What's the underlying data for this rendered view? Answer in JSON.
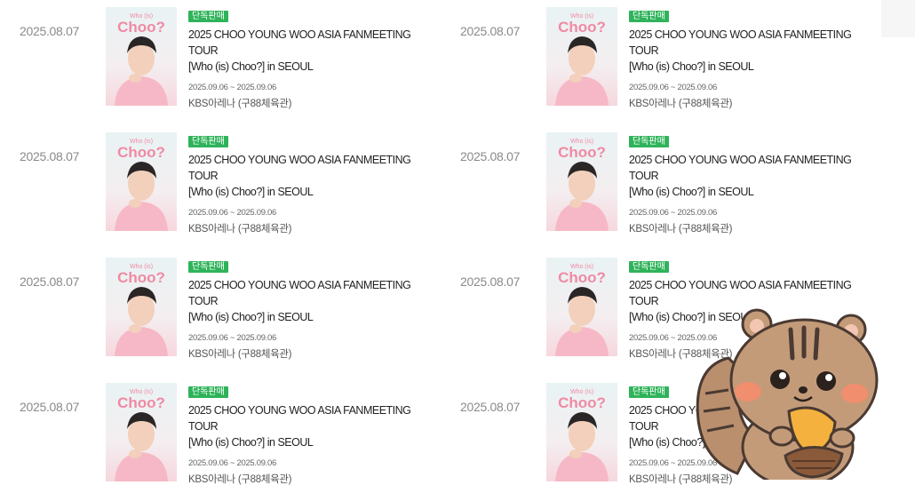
{
  "items": [
    {
      "date": "2025.08.07",
      "badge": "단독판매",
      "title_line1": "2025 CHOO YOUNG WOO ASIA FANMEETING TOUR",
      "title_line2": "[Who (is) Choo?] in SEOUL",
      "period": "2025.09.06 ~ 2025.09.06",
      "venue": "KBS아레나 (구88체육관)",
      "poster_text": "Choo?",
      "poster_small": "Who (is)"
    },
    {
      "date": "2025.08.07",
      "badge": "단독판매",
      "title_line1": "2025 CHOO YOUNG WOO ASIA FANMEETING TOUR",
      "title_line2": "[Who (is) Choo?] in SEOUL",
      "period": "2025.09.06 ~ 2025.09.06",
      "venue": "KBS아레나 (구88체육관)",
      "poster_text": "Choo?",
      "poster_small": "Who (is)"
    },
    {
      "date": "2025.08.07",
      "badge": "단독판매",
      "title_line1": "2025 CHOO YOUNG WOO ASIA FANMEETING TOUR",
      "title_line2": "[Who (is) Choo?] in SEOUL",
      "period": "2025.09.06 ~ 2025.09.06",
      "venue": "KBS아레나 (구88체육관)",
      "poster_text": "Choo?",
      "poster_small": "Who (is)"
    },
    {
      "date": "2025.08.07",
      "badge": "단독판매",
      "title_line1": "2025 CHOO YOUNG WOO ASIA FANMEETING TOUR",
      "title_line2": "[Who (is) Choo?] in SEOUL",
      "period": "2025.09.06 ~ 2025.09.06",
      "venue": "KBS아레나 (구88체육관)",
      "poster_text": "Choo?",
      "poster_small": "Who (is)"
    },
    {
      "date": "2025.08.07",
      "badge": "단독판매",
      "title_line1": "2025 CHOO YOUNG WOO ASIA FANMEETING TOUR",
      "title_line2": "[Who (is) Choo?] in SEOUL",
      "period": "2025.09.06 ~ 2025.09.06",
      "venue": "KBS아레나 (구88체육관)",
      "poster_text": "Choo?",
      "poster_small": "Who (is)"
    },
    {
      "date": "2025.08.07",
      "badge": "단독판매",
      "title_line1": "2025 CHOO YOUNG WOO ASIA FANMEETING TOUR",
      "title_line2": "[Who (is) Choo?] in SEOUL",
      "period": "2025.09.06 ~ 2025.09.06",
      "venue": "KBS아레나 (구88체육관)",
      "poster_text": "Choo?",
      "poster_small": "Who (is)"
    },
    {
      "date": "2025.08.07",
      "badge": "단독판매",
      "title_line1": "2025 CHOO YOUNG WOO ASIA FANMEETING TOUR",
      "title_line2": "[Who (is) Choo?] in SEOUL",
      "period": "2025.09.06 ~ 2025.09.06",
      "venue": "KBS아레나 (구88체육관)",
      "poster_text": "Choo?",
      "poster_small": "Who (is)"
    },
    {
      "date": "2025.08.07",
      "badge": "단독판매",
      "title_line1": "2025 CHOO YOUNG WOO ASIA FANMEETING TOUR",
      "title_line2": "[Who (is) Choo?] in SEOUL",
      "period": "2025.09.06 ~ 2025.09.06",
      "venue": "KBS아레나 (구88체육관)",
      "poster_text": "Choo?",
      "poster_small": "Who (is)"
    }
  ],
  "colors": {
    "badge": "#2fb35a",
    "poster_text": "#f08aa4",
    "date": "#8a8a8a"
  },
  "icons": {
    "sticker": "chipmunk-holding-acorn-sticker",
    "scroll": "scroll-top-button"
  }
}
